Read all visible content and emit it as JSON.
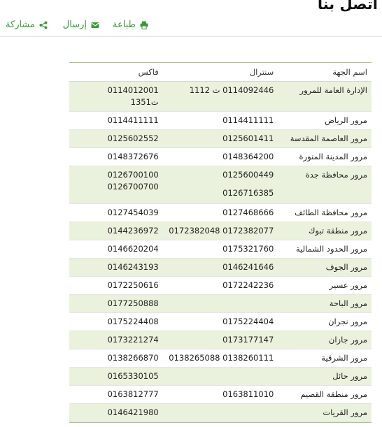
{
  "page": {
    "title": "اتصل بنا"
  },
  "actions": {
    "print_label": "طباعة",
    "send_label": "إرسال",
    "share_label": "مشاركة"
  },
  "table": {
    "headers": {
      "name": "اسم الجهة",
      "central": "سنترال",
      "fax": "فاكس"
    },
    "rows": [
      {
        "name": "الإدارة العامة للمرور",
        "central": [
          "0114092446 ت 1112"
        ],
        "fax": [
          "0114012001",
          "ت1351"
        ]
      },
      {
        "name": "مرور الرياض",
        "central": [
          "0114411111"
        ],
        "fax": [
          "0114411111"
        ]
      },
      {
        "name": "مرور العاصمة المقدسة",
        "central": [
          "0125601411"
        ],
        "fax": [
          "0125602552"
        ]
      },
      {
        "name": "مرور المدينة المنورة",
        "central": [
          "0148364200"
        ],
        "fax": [
          "0148372676"
        ]
      },
      {
        "name": "مرور محافظة جدة",
        "central": [
          "0125600449",
          "0126716385"
        ],
        "fax": [
          "0126700100",
          "0126700700"
        ]
      },
      {
        "name": "مرور محافظة الطائف",
        "central": [
          "0127468666"
        ],
        "fax": [
          "0127454039"
        ]
      },
      {
        "name": "مرور منطقة تبوك",
        "central": [
          "0172382077 0172382048"
        ],
        "fax": [
          "0144236972"
        ]
      },
      {
        "name": "مرور الحدود الشمالية",
        "central": [
          "0175321760"
        ],
        "fax": [
          "0146620204"
        ]
      },
      {
        "name": "مرور الجوف",
        "central": [
          "0146241646"
        ],
        "fax": [
          "0146243193"
        ]
      },
      {
        "name": "مرور عسير",
        "central": [
          "0172242236"
        ],
        "fax": [
          "0172250616"
        ]
      },
      {
        "name": "مرور الباحة",
        "central": [],
        "fax": [
          "0177250888"
        ]
      },
      {
        "name": "مرور نجران",
        "central": [
          "0175224404"
        ],
        "fax": [
          "0175224408"
        ]
      },
      {
        "name": "مرور جازان",
        "central": [
          "0173177147"
        ],
        "fax": [
          "0173221274"
        ]
      },
      {
        "name": "مرور الشرقية",
        "central": [
          "0138260111 0138265088"
        ],
        "fax": [
          "0138266870"
        ]
      },
      {
        "name": "مرور حائل",
        "central": [],
        "fax": [
          "0165330105"
        ]
      },
      {
        "name": "مرور منطقة القصيم",
        "central": [
          "0163811010"
        ],
        "fax": [
          "0163812777"
        ]
      },
      {
        "name": "مرور القريات",
        "central": [],
        "fax": [
          "0146421980"
        ]
      }
    ]
  },
  "colors": {
    "accent_green": "#3a9a3a",
    "row_alt": "#eaf1dc",
    "table_border": "#a8c68a"
  }
}
